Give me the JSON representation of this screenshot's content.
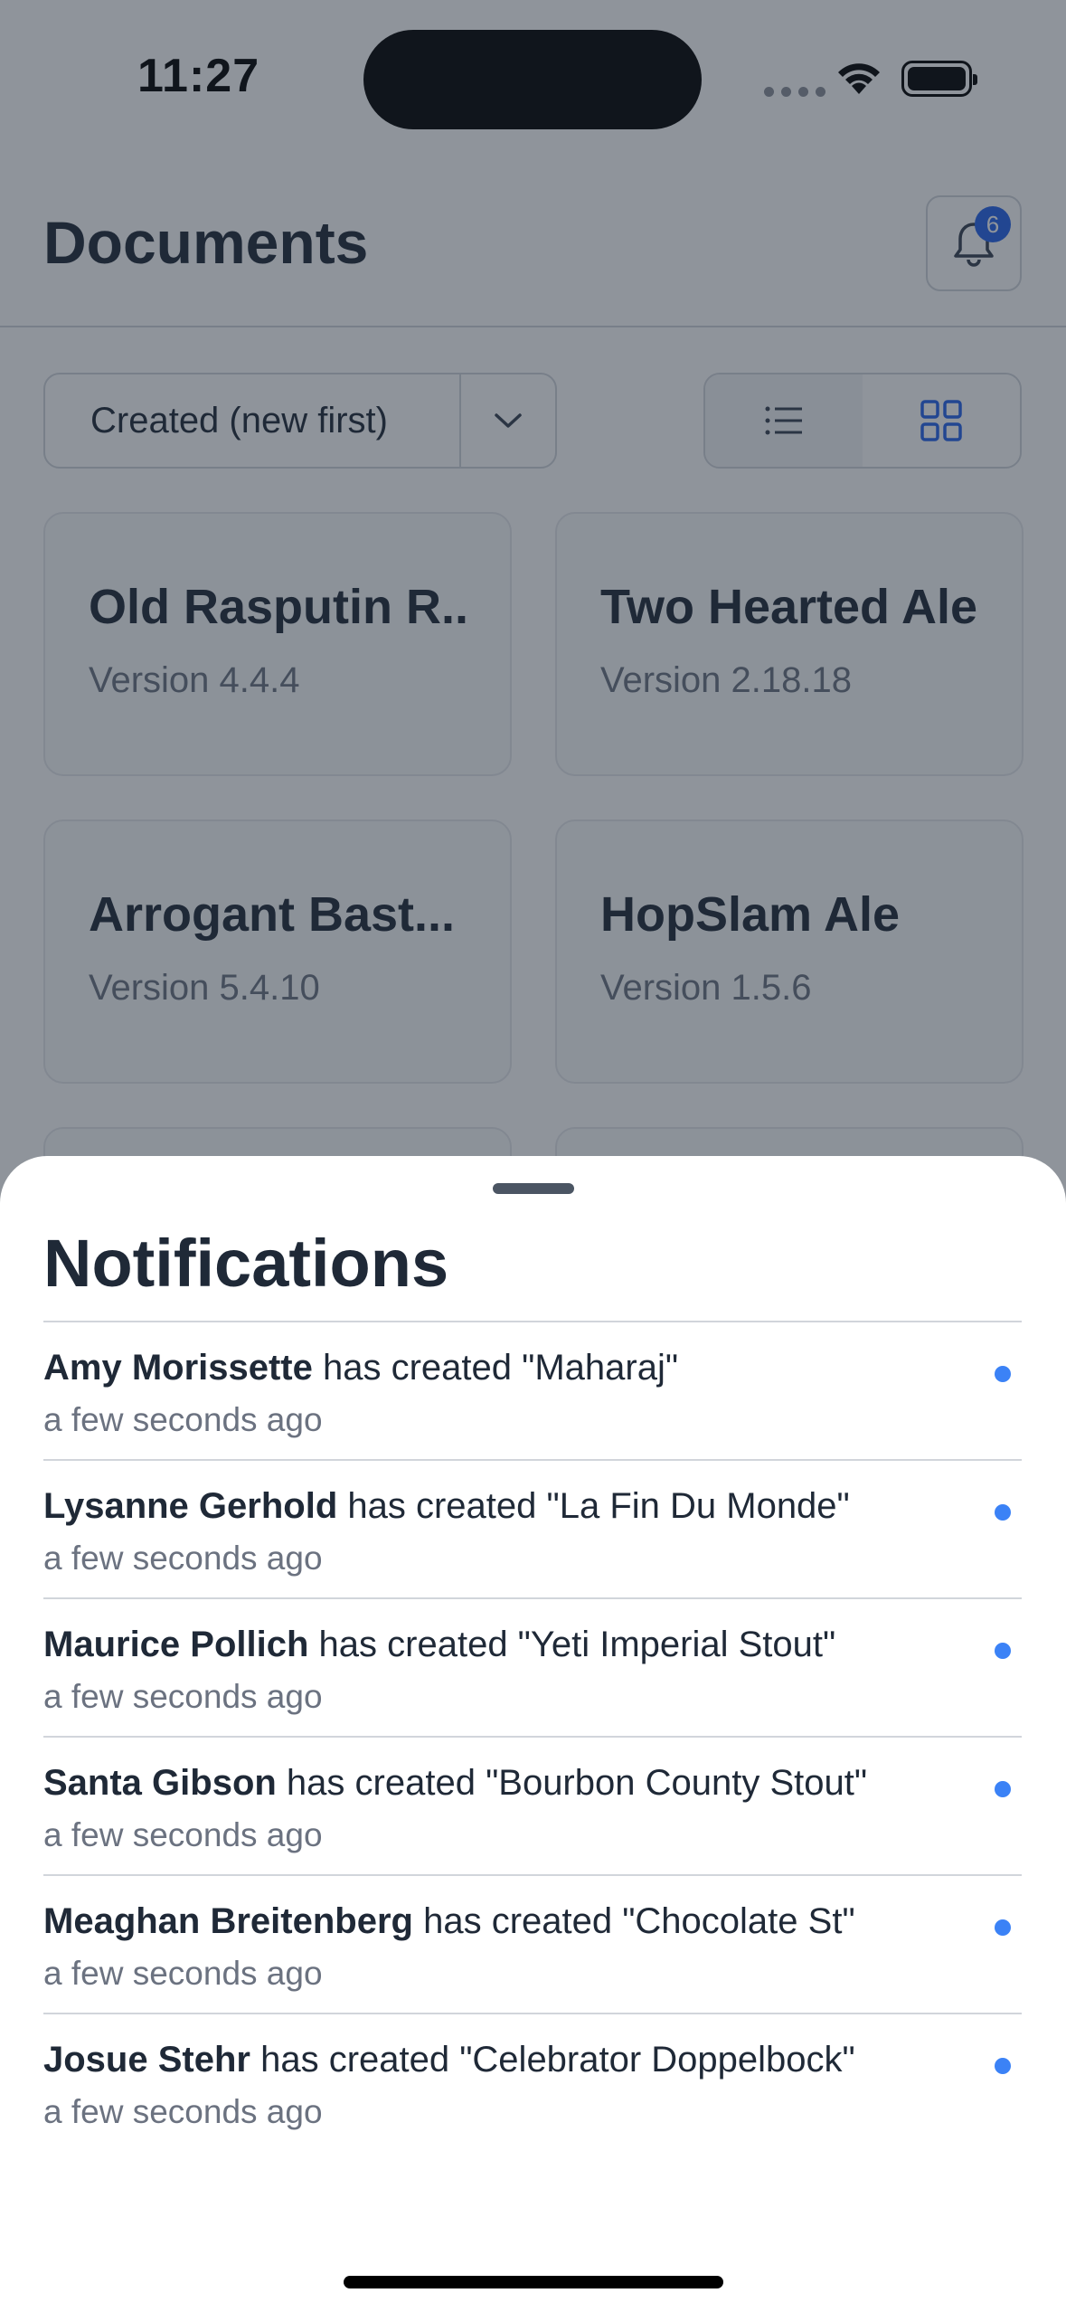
{
  "status_bar": {
    "time": "11:27"
  },
  "header": {
    "title": "Documents",
    "notification_count": "6"
  },
  "controls": {
    "sort_value": "Created (new first)",
    "view_mode": "grid"
  },
  "documents": [
    {
      "title": "Old Rasputin Russian Imperial Stout",
      "version": "Version 4.4.4"
    },
    {
      "title": "Two Hearted Ale",
      "version": "Version 2.18.18"
    },
    {
      "title": "Arrogant Bastard Ale",
      "version": "Version 5.4.10"
    },
    {
      "title": "HopSlam Ale",
      "version": "Version 1.5.6"
    }
  ],
  "sheet": {
    "title": "Notifications",
    "items": [
      {
        "actor": "Amy Morissette",
        "action": " has created \"Maharaj\"",
        "time": "a few seconds ago"
      },
      {
        "actor": "Lysanne Gerhold",
        "action": " has created \"La Fin Du Monde\"",
        "time": "a few seconds ago"
      },
      {
        "actor": "Maurice Pollich",
        "action": " has created \"Yeti Imperial Stout\"",
        "time": "a few seconds ago"
      },
      {
        "actor": "Santa Gibson",
        "action": " has created \"Bourbon County Stout\"",
        "time": "a few seconds ago"
      },
      {
        "actor": "Meaghan Breitenberg",
        "action": " has created \"Chocolate St\"",
        "time": "a few seconds ago"
      },
      {
        "actor": "Josue Stehr",
        "action": " has created \"Celebrator Doppelbock\"",
        "time": "a few seconds ago"
      }
    ]
  },
  "colors": {
    "accent": "#2563eb",
    "unread_dot": "#3b82f6",
    "overlay": "#1f2937"
  }
}
